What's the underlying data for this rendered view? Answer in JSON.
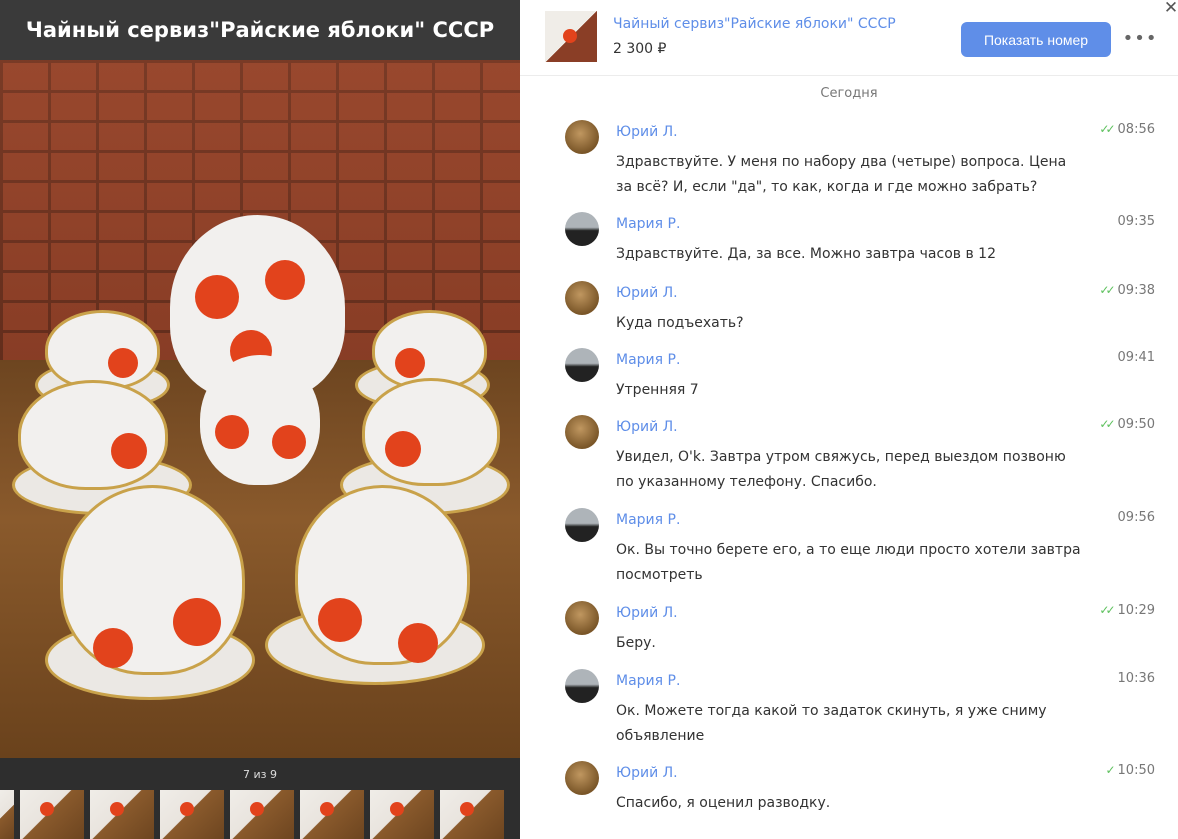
{
  "gallery": {
    "title": "Чайный сервиз\"Райские яблоки\" СССР",
    "counter": "7 из 9"
  },
  "header": {
    "title": "Чайный сервиз\"Райские яблоки\" СССР",
    "price": "2 300 ₽",
    "show_number_label": "Показать номер",
    "more_label": "•••",
    "close_label": "✕"
  },
  "chat": {
    "day_label": "Сегодня",
    "messages": [
      {
        "author": "Юрий Л.",
        "text": "Здравствуйте. У меня по набору два (четыре) вопроса. Цена за всё? И, если \"да\", то как, когда и где можно забрать?",
        "time": "08:56",
        "read": "✓✓"
      },
      {
        "author": "Мария Р.",
        "text": "Здравствуйте. Да, за все. Можно завтра часов в 12",
        "time": "09:35",
        "read": ""
      },
      {
        "author": "Юрий Л.",
        "text": "Куда подъехать?",
        "time": "09:38",
        "read": "✓✓"
      },
      {
        "author": "Мария Р.",
        "text": "Утренняя 7",
        "time": "09:41",
        "read": ""
      },
      {
        "author": "Юрий Л.",
        "text": "Увидел, O'k. Завтра утром свяжусь, перед выездом позвоню по указанному телефону. Спасибо.",
        "time": "09:50",
        "read": "✓✓"
      },
      {
        "author": "Мария Р.",
        "text": "Ок. Вы точно берете его, а то еще люди просто хотели завтра посмотреть",
        "time": "09:56",
        "read": ""
      },
      {
        "author": "Юрий Л.",
        "text": "Беру.",
        "time": "10:29",
        "read": "✓✓"
      },
      {
        "author": "Мария Р.",
        "text": "Ок. Можете тогда какой то задаток скинуть, я уже сниму объявление",
        "time": "10:36",
        "read": ""
      },
      {
        "author": "Юрий Л.",
        "text": "Спасибо, я оценил разводку.",
        "time": "10:50",
        "read": "✓"
      }
    ]
  }
}
